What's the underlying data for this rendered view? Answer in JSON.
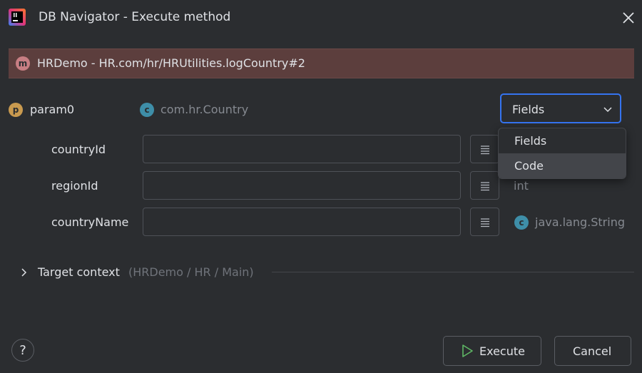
{
  "window": {
    "title": "DB Navigator - Execute method",
    "logo_icon": "jetbrains-logo-icon",
    "close_icon": "close-icon"
  },
  "method": {
    "badge": "m",
    "signature": "HRDemo - HR.com/hr/HRUtilities.logCountry#2"
  },
  "param": {
    "badge": "p",
    "name": "param0",
    "type_badge": "c",
    "type": "com.hr.Country",
    "mode_select": {
      "value": "Fields",
      "options": [
        "Fields",
        "Code"
      ],
      "highlighted": "Code"
    }
  },
  "fields": [
    {
      "name": "countryId",
      "value": "",
      "type_badge": "",
      "type": ""
    },
    {
      "name": "regionId",
      "value": "",
      "type_badge": "",
      "type": "int"
    },
    {
      "name": "countryName",
      "value": "",
      "type_badge": "c",
      "type": "java.lang.String"
    }
  ],
  "target_context": {
    "label": "Target context",
    "detail": "(HRDemo / HR / Main)"
  },
  "footer": {
    "help": "?",
    "execute_label": "Execute",
    "cancel_label": "Cancel"
  },
  "colors": {
    "background": "#2b2d30",
    "method_bar": "#5c3e3d",
    "accent": "#3574f0",
    "run_green": "#5fb865"
  }
}
